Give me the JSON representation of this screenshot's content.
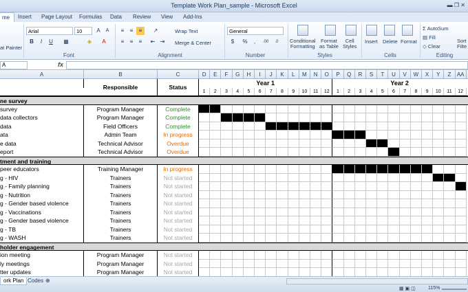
{
  "window": {
    "title": "Template Work Plan_sample - Microsoft Excel"
  },
  "tabs": [
    "me",
    "Insert",
    "Page Layout",
    "Formulas",
    "Data",
    "Review",
    "View",
    "Add-Ins"
  ],
  "ribbon": {
    "paste_partial": "at Painter",
    "font_name": "Arial",
    "font_size": "10",
    "wrap_text": "Wrap Text",
    "merge_center": "Merge & Center",
    "number_format": "General",
    "cond_format": "Conditional\nFormatting",
    "format_table": "Format\nas Table",
    "cell_styles": "Cell\nStyles",
    "insert": "Insert",
    "delete": "Delete",
    "format": "Format",
    "autosum": "AutoSum",
    "fill": "Fill",
    "clear": "Clear",
    "sort_partial": "Sort\nFilte",
    "groups": {
      "font": "Font",
      "alignment": "Alignment",
      "number": "Number",
      "styles": "Styles",
      "cells": "Cells",
      "editing": "Editing"
    }
  },
  "formula_bar": {
    "name_box": "A",
    "fx": "fx"
  },
  "columns": [
    "A",
    "B",
    "C",
    "D",
    "E",
    "F",
    "G",
    "H",
    "I",
    "J",
    "K",
    "L",
    "M",
    "N",
    "O",
    "P",
    "Q",
    "R",
    "S",
    "T",
    "U",
    "V",
    "W",
    "X",
    "Y",
    "Z",
    "AA"
  ],
  "header": {
    "responsible": "Responsible",
    "status": "Status",
    "year1": "Year 1",
    "year2": "Year 2",
    "months": [
      "1",
      "2",
      "3",
      "4",
      "5",
      "6",
      "7",
      "8",
      "9",
      "10",
      "11",
      "12"
    ]
  },
  "rows": [
    {
      "type": "section",
      "a": "ne survey"
    },
    {
      "type": "task",
      "a": "survey",
      "b": "Program Manager",
      "c": "Complete",
      "color": "#2e8b2e",
      "bars": [
        0,
        1
      ]
    },
    {
      "type": "task",
      "a": "data collectors",
      "b": "Program Manager",
      "c": "Complete",
      "color": "#2e8b2e",
      "bars": [
        2,
        3,
        4,
        5
      ]
    },
    {
      "type": "task",
      "a": "data",
      "b": "Field Officers",
      "c": "Complete",
      "color": "#2e8b2e",
      "bars": [
        6,
        7,
        8,
        9,
        10,
        11
      ]
    },
    {
      "type": "task",
      "a": "ata",
      "b": "Admin Team",
      "c": "In progress",
      "color": "#e46c0a",
      "bars": [
        12,
        13,
        14
      ]
    },
    {
      "type": "task",
      "a": "e data",
      "b": "Technical Advisor",
      "c": "Overdue",
      "color": "#e46c0a",
      "bars": [
        15,
        16
      ]
    },
    {
      "type": "task",
      "a": "eport",
      "b": "Technical Advisor",
      "c": "Overdue",
      "color": "#e46c0a",
      "bars": [
        17
      ]
    },
    {
      "type": "section",
      "a": "tment and training"
    },
    {
      "type": "task",
      "a": "peer educators",
      "b": "Training Manager",
      "c": "In progress",
      "color": "#e46c0a",
      "bars": [
        12,
        13,
        14,
        15,
        16,
        17,
        18,
        19,
        20
      ]
    },
    {
      "type": "task",
      "a": "g - HIV",
      "b": "Trainers",
      "c": "Not started",
      "color": "#a6a6a6",
      "bars": [
        21,
        22
      ]
    },
    {
      "type": "task",
      "a": "g - Family planning",
      "b": "Trainers",
      "c": "Not started",
      "color": "#a6a6a6",
      "bars": [
        23,
        24
      ]
    },
    {
      "type": "task",
      "a": "g - Nutrition",
      "b": "Trainers",
      "c": "Not started",
      "color": "#a6a6a6",
      "bars": []
    },
    {
      "type": "task",
      "a": "g - Gender based violence",
      "b": "Trainers",
      "c": "Not started",
      "color": "#a6a6a6",
      "bars": []
    },
    {
      "type": "task",
      "a": "g - Vaccinations",
      "b": "Trainers",
      "c": "Not started",
      "color": "#a6a6a6",
      "bars": []
    },
    {
      "type": "task",
      "a": "g - Gender based violence",
      "b": "Trainers",
      "c": "Not started",
      "color": "#a6a6a6",
      "bars": []
    },
    {
      "type": "task",
      "a": "g - TB",
      "b": "Trainers",
      "c": "Not started",
      "color": "#a6a6a6",
      "bars": []
    },
    {
      "type": "task",
      "a": "g - WASH",
      "b": "Trainers",
      "c": "Not started",
      "color": "#a6a6a6",
      "bars": []
    },
    {
      "type": "section",
      "a": "holder engagement"
    },
    {
      "type": "task",
      "a": "ion meeting",
      "b": "Program Manager",
      "c": "Not started",
      "color": "#a6a6a6",
      "bars": []
    },
    {
      "type": "task",
      "a": "ly meetings",
      "b": "Program Manager",
      "c": "Not started",
      "color": "#a6a6a6",
      "bars": []
    },
    {
      "type": "task",
      "a": "tter updates",
      "b": "Program Manager",
      "c": "Not started",
      "color": "#a6a6a6",
      "bars": []
    }
  ],
  "sheets": [
    "ork Plan",
    "Codes"
  ],
  "zoom": "115%"
}
